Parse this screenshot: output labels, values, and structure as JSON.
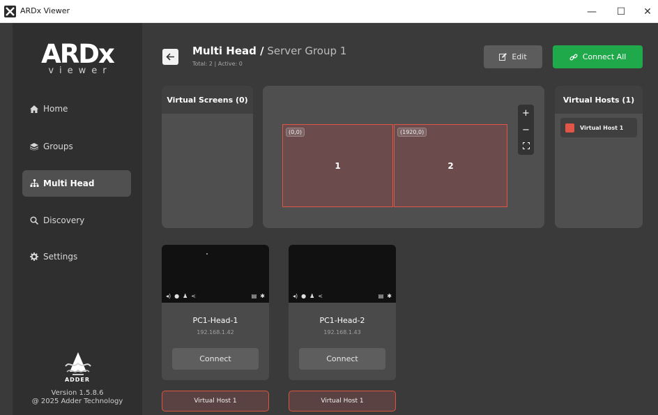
{
  "window": {
    "title": "ARDx Viewer",
    "minimize": "—",
    "maximize": "☐",
    "close": "✕"
  },
  "sidebar": {
    "logo_main": "ARDx",
    "logo_sub": "viewer",
    "items": [
      {
        "label": "Home",
        "icon": "home-icon",
        "active": false
      },
      {
        "label": "Groups",
        "icon": "layers-icon",
        "active": false
      },
      {
        "label": "Multi Head",
        "icon": "sitemap-icon",
        "active": true
      },
      {
        "label": "Discovery",
        "icon": "search-icon",
        "active": false
      },
      {
        "label": "Settings",
        "icon": "gear-icon",
        "active": false
      }
    ],
    "brand": "ADDER",
    "version": "Version 1.5.8.6",
    "copyright": "@ 2025 Adder Technology"
  },
  "header": {
    "title": "Multi Head /",
    "group_name": "Server Group 1",
    "subtitle": "Total: 2 | Active: 0",
    "edit_label": "Edit",
    "connect_all_label": "Connect All"
  },
  "panels": {
    "virtual_screens_title": "Virtual Screens (0)",
    "virtual_hosts_title": "Virtual Hosts (1)",
    "virtual_hosts": [
      {
        "label": "Virtual Host 1",
        "color": "#e05545"
      }
    ]
  },
  "layout": {
    "screens": [
      {
        "number": "1",
        "coord": "(0,0)"
      },
      {
        "number": "2",
        "coord": "(1920,0)"
      }
    ],
    "zoom_in": "+",
    "zoom_out": "−",
    "fit": "⛶"
  },
  "devices": [
    {
      "name": "PC1-Head-1",
      "ip": "192.168.1.42",
      "connect_label": "Connect",
      "host": "Virtual Host 1"
    },
    {
      "name": "PC1-Head-2",
      "ip": "192.168.1.43",
      "connect_label": "Connect",
      "host": "Virtual Host 1"
    }
  ],
  "colors": {
    "accent_green": "#1fa94a",
    "host_red": "#e05545"
  }
}
